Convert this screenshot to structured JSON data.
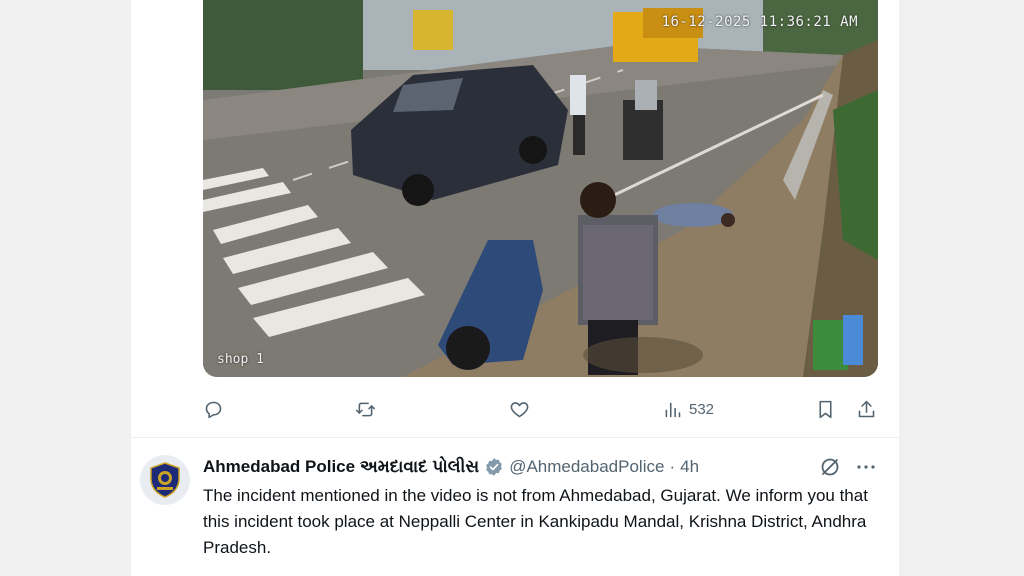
{
  "video": {
    "timestamp": "16-12-2025 11:36:21 AM",
    "camera_label": "shop 1"
  },
  "actions": {
    "reply_icon": "reply-icon",
    "retweet_icon": "retweet-icon",
    "like_icon": "like-icon",
    "views_icon": "views-icon",
    "views_count": "532",
    "bookmark_icon": "bookmark-icon",
    "share_icon": "share-icon"
  },
  "tweet": {
    "display_name": "Ahmedabad Police અમદાવાદ પોલીસ",
    "handle": "@AhmedabadPolice",
    "separator": "·",
    "time": "4h",
    "text": "The incident mentioned in the video is not from Ahmedabad, Gujarat. We inform you that this incident took place at Neppalli Center in Kankipadu Mandal, Krishna District, Andhra Pradesh."
  },
  "colors": {
    "text_primary": "#0f1419",
    "text_secondary": "#536471",
    "verified": "#829aab",
    "page_bg": "#f0f0f0"
  }
}
